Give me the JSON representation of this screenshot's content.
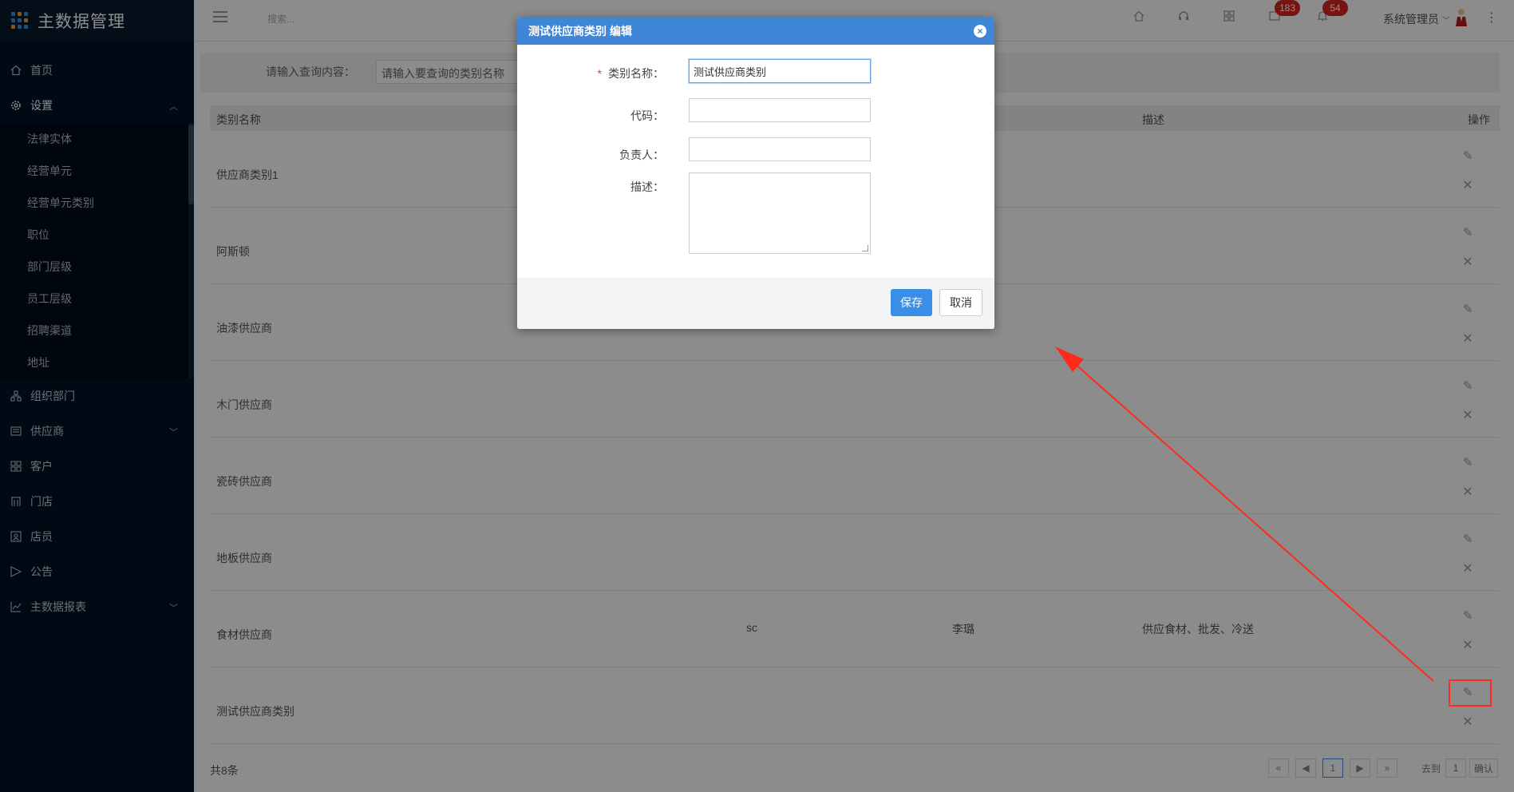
{
  "brand": {
    "title": "主数据管理"
  },
  "sidebar": {
    "items": [
      {
        "label": "首页",
        "icon": "home-icon"
      },
      {
        "label": "设置",
        "icon": "gear-icon",
        "open": true
      },
      {
        "label": "组织部门",
        "icon": "org-icon"
      },
      {
        "label": "供应商",
        "icon": "supplier-icon",
        "has_children": true
      },
      {
        "label": "客户",
        "icon": "customer-icon"
      },
      {
        "label": "门店",
        "icon": "store-icon"
      },
      {
        "label": "店员",
        "icon": "clerk-icon"
      },
      {
        "label": "公告",
        "icon": "announcement-icon"
      },
      {
        "label": "主数据报表",
        "icon": "chart-icon",
        "has_children": true
      }
    ],
    "settings_sub": [
      "法律实体",
      "经营单元",
      "经营单元类别",
      "职位",
      "部门层级",
      "员工层级",
      "招聘渠道",
      "地址"
    ]
  },
  "topbar": {
    "search_placeholder": "搜索...",
    "badge_messages": "183",
    "badge_notifications": "54",
    "user_name": "系统管理员"
  },
  "filter": {
    "label": "请输入查询内容：",
    "placeholder": "请输入要查询的类别名称"
  },
  "table": {
    "headers": {
      "name": "类别名称",
      "desc": "描述",
      "op": "操作"
    },
    "rows": [
      {
        "name": "供应商类别1",
        "code": "",
        "owner": "",
        "desc": ""
      },
      {
        "name": "阿斯顿",
        "code": "",
        "owner": "",
        "desc": ""
      },
      {
        "name": "油漆供应商",
        "code": "",
        "owner": "",
        "desc": ""
      },
      {
        "name": "木门供应商",
        "code": "",
        "owner": "",
        "desc": ""
      },
      {
        "name": "瓷砖供应商",
        "code": "",
        "owner": "",
        "desc": ""
      },
      {
        "name": "地板供应商",
        "code": "",
        "owner": "",
        "desc": ""
      },
      {
        "name": "食材供应商",
        "code": "sc",
        "owner": "李璐",
        "desc": "供应食材、批发、冷送"
      },
      {
        "name": "测试供应商类别",
        "code": "",
        "owner": "",
        "desc": ""
      }
    ]
  },
  "footer": {
    "total": "共8条"
  },
  "pager": {
    "first": "«",
    "prev": "◀",
    "current": "1",
    "next": "▶",
    "last": "»",
    "goto_label": "去到",
    "goto_value": "1",
    "confirm": "确认"
  },
  "modal": {
    "title": "测试供应商类别 编辑",
    "close": "×",
    "name_label": "类别名称：",
    "name_value": "测试供应商类别",
    "code_label": "代码：",
    "code_value": "",
    "owner_label": "负责人：",
    "owner_value": "",
    "desc_label": "描述：",
    "required_mark": "*",
    "save": "保存",
    "cancel": "取消"
  },
  "colors": {
    "sidebar_bg": "#011225",
    "accent": "#3a8ee6",
    "header_blue": "#3f85d8",
    "badge_red": "#d9241f",
    "annotation_red": "#ff2a1a"
  }
}
